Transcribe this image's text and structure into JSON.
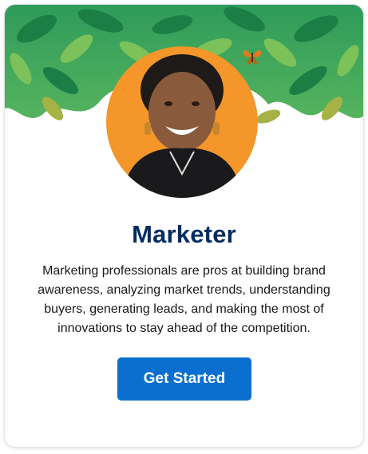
{
  "card": {
    "title": "Marketer",
    "description": "Marketing professionals are pros at building brand awareness, analyzing market trends, understanding buyers, generating leads, and making the most of innovations to stay ahead of the competition.",
    "cta_label": "Get Started"
  },
  "colors": {
    "title": "#032d60",
    "button": "#0b6fcf",
    "avatar_background": "#f4962a",
    "foliage_dark": "#1f8a4c",
    "foliage_light": "#6bbf59"
  },
  "icons": {
    "avatar": "person-portrait",
    "decoration": "butterfly"
  }
}
